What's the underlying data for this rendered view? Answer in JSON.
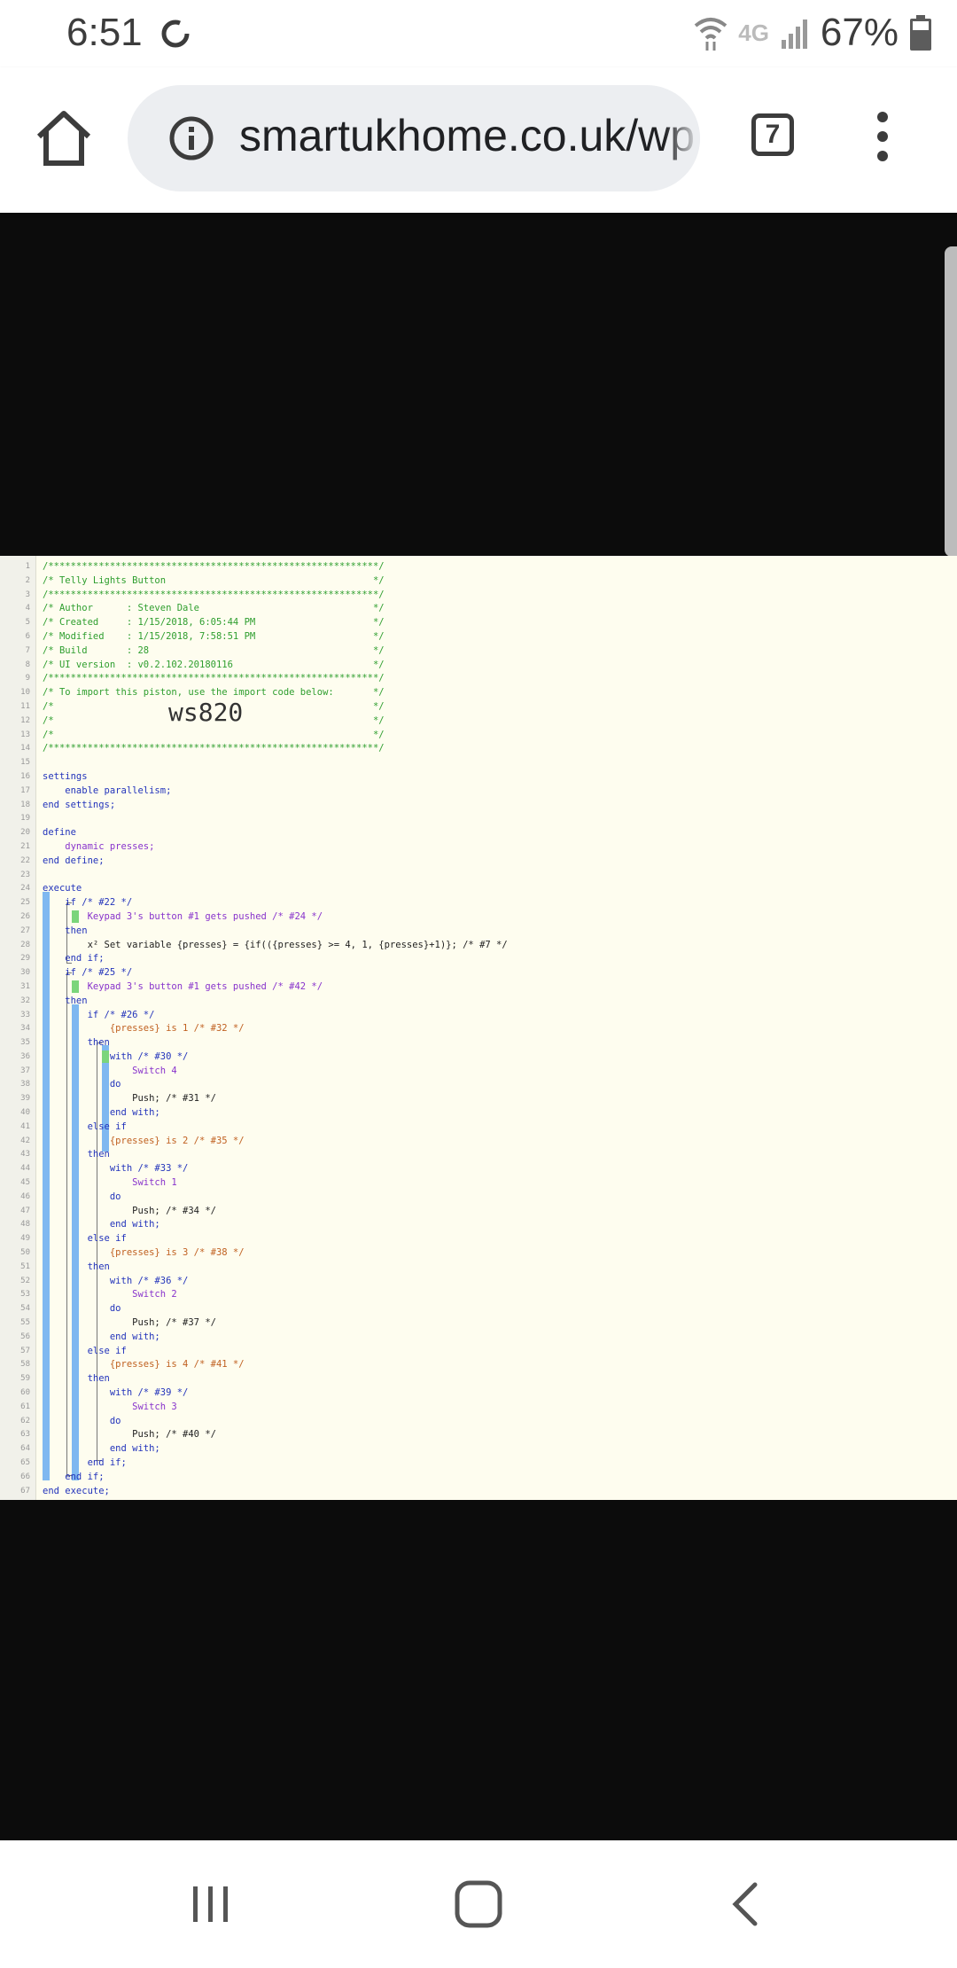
{
  "status": {
    "time": "6:51",
    "network": "4G",
    "battery": "67%"
  },
  "browser": {
    "url": "smartukhome.co.uk/wp",
    "tab_count": "7"
  },
  "code": {
    "lines": [
      "/***********************************************************/",
      "/* Telly Lights Button                                     */",
      "/***********************************************************/",
      "/* Author      : Steven Dale                               */",
      "/* Created     : 1/15/2018, 6:05:44 PM                     */",
      "/* Modified    : 1/15/2018, 7:58:51 PM                     */",
      "/* Build       : 28                                        */",
      "/* UI version  : v0.2.102.20180116                         */",
      "/***********************************************************/",
      "/* To import this piston, use the import code below:       */",
      "/*                                                         */",
      "/*                                                         */",
      "/*                                                         */",
      "/***********************************************************/",
      "",
      "settings",
      "    enable parallelism;",
      "end settings;",
      "",
      "define",
      "    dynamic presses;",
      "end define;",
      "",
      "execute",
      "    if /* #22 */",
      "        Keypad 3's button #1 gets pushed /* #24 */",
      "    then",
      "        x² Set variable {presses} = {if(({presses} >= 4, 1, {presses}+1)}; /* #7 */",
      "    end if;",
      "    if /* #25 */",
      "        Keypad 3's button #1 gets pushed /* #42 */",
      "    then",
      "        if /* #26 */",
      "            {presses} is 1 /* #32 */",
      "        then",
      "            with /* #30 */",
      "                Switch 4",
      "            do",
      "                Push; /* #31 */",
      "            end with;",
      "        else if",
      "            {presses} is 2 /* #35 */",
      "        then",
      "            with /* #33 */",
      "                Switch 1",
      "            do",
      "                Push; /* #34 */",
      "            end with;",
      "        else if",
      "            {presses} is 3 /* #38 */",
      "        then",
      "            with /* #36 */",
      "                Switch 2",
      "            do",
      "                Push; /* #37 */",
      "            end with;",
      "        else if",
      "            {presses} is 4 /* #41 */",
      "        then",
      "            with /* #39 */",
      "                Switch 3",
      "            do",
      "                Push; /* #40 */",
      "            end with;",
      "        end if;",
      "    end if;",
      "end execute;"
    ],
    "import_code": "ws820"
  }
}
